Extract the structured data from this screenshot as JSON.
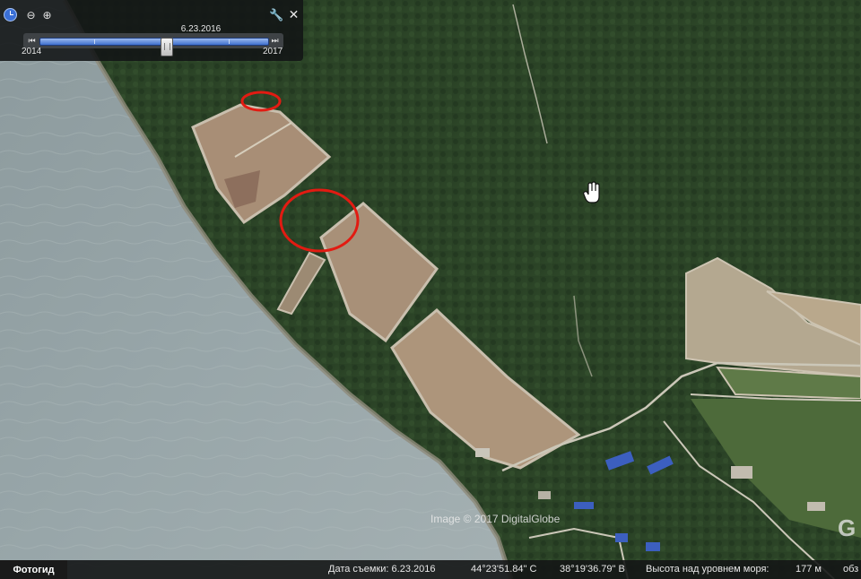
{
  "time_slider": {
    "date": "6.23.16",
    "date_display": "6.23.2016",
    "start_year": "2014",
    "end_year": "2017",
    "position": 0.55
  },
  "icons": {
    "clock": "clock-icon",
    "zoom_out": "zoom-out-icon",
    "zoom_in": "zoom-in-icon",
    "settings": "wrench-icon",
    "close": "close-icon",
    "cursor": "hand-cursor-icon"
  },
  "map": {
    "copyright": "Image © 2017 DigitalGlobe",
    "watermark": "G",
    "highlight_color": "#e21b12"
  },
  "status_bar": {
    "guide_button": "Фотогид",
    "capture_date": "Дата съемки: 6.23.2016",
    "latitude": "44°23'51.84\" С",
    "longitude": "38°19'36.79\" В",
    "elevation_label": "Высота над уровнем моря:",
    "elevation_value": "177 м",
    "overflow_text": "обз"
  }
}
